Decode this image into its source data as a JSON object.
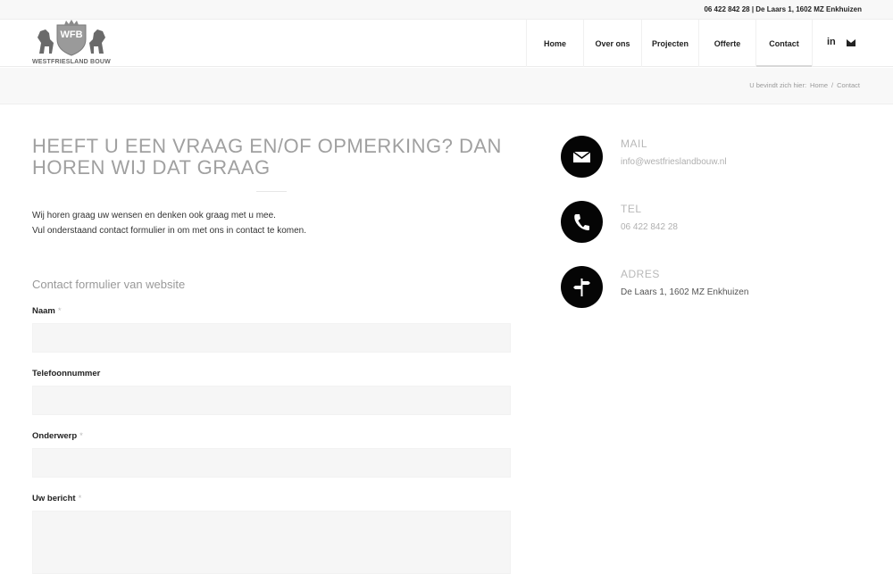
{
  "topbar": {
    "contact_info": "06 422 842 28 | De Laars 1, 1602 MZ Enkhuizen"
  },
  "logo": {
    "monogram": "WFB",
    "name": "WESTFRIESLAND BOUW"
  },
  "nav": {
    "items": [
      {
        "label": "Home"
      },
      {
        "label": "Over ons"
      },
      {
        "label": "Projecten"
      },
      {
        "label": "Offerte"
      },
      {
        "label": "Contact"
      }
    ],
    "social": {
      "linkedin": "in"
    }
  },
  "breadcrumb": {
    "prefix": "U bevindt zich hier:",
    "home": "Home",
    "separator": "/",
    "current": "Contact"
  },
  "main": {
    "heading": "Heeft u een vraag en/of opmerking? Dan horen wij dat graag",
    "intro_line1": "Wij horen graag uw wensen en denken ook graag met u mee.",
    "intro_line2": "Vul onderstaand contact formulier in om met ons in contact te komen."
  },
  "form": {
    "title": "Contact formulier van website",
    "required_mark": "*",
    "fields": [
      {
        "label": "Naam"
      },
      {
        "label": "Telefoonnummer"
      },
      {
        "label": "Onderwerp"
      },
      {
        "label": "Uw bericht"
      }
    ]
  },
  "contact": {
    "mail": {
      "title": "MAIL",
      "value": "info@westfrieslandbouw.nl"
    },
    "tel": {
      "title": "TEL",
      "value": "06 422 842 28"
    },
    "adres": {
      "title": "ADRES",
      "value": "De Laars 1, 1602 MZ Enkhuizen"
    }
  },
  "colors": {
    "accent": "#050505",
    "muted": "#a0a0a0",
    "field_bg": "#f6f6f6"
  }
}
